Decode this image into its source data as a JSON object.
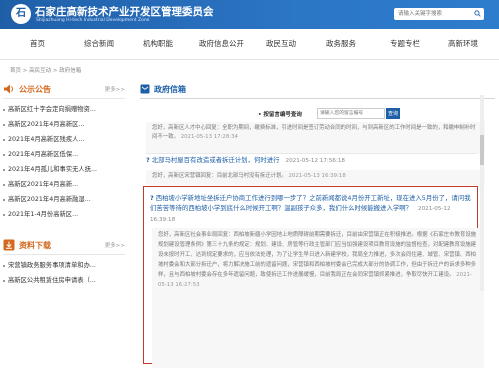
{
  "header": {
    "logo_text": "石",
    "title": "石家庄高新技术产业开发区管理委员会",
    "subtitle": "Shijiazhuang Hi-tech Industrial Development Zone",
    "search_placeholder": "请输入关键字搜索",
    "colors": {
      "bar": "#1f5fa8",
      "accent": "#d2691e",
      "highlight_border": "#c0392b"
    }
  },
  "nav": {
    "items": [
      "首页",
      "综合新闻",
      "机构职能",
      "政府信息公开",
      "政民互动",
      "政务服务",
      "专题专栏",
      "高新环境"
    ]
  },
  "breadcrumb": "首页 > 高民互动 > 政府信箱",
  "sidebar": {
    "notice": {
      "title": "公示公告",
      "more": "更多>>",
      "items": [
        "高新区红十字会定向捐赠物资...",
        "高新区2021年4月高新区...",
        "2021年4月高新区残疾人...",
        "2021年4月高新区低保...",
        "2021年4月孤儿和事实无人抚...",
        "高新区2021年4月高新...",
        "高新区2021年4月高新融湿...",
        "2021年1-4月份高新区..."
      ]
    },
    "download": {
      "title": "资料下载",
      "more": "更多>>",
      "items": [
        "宋营镇政务服务事项清单和办...",
        "高新区公共租赁住房申请表（..."
      ]
    }
  },
  "main": {
    "title": "政府信箱",
    "search_label": "• 按留言编号查询",
    "search_placeholder": "请输入您的留言编号",
    "search_button": "查询",
    "items": [
      {
        "answer": "您好，高新区人才中心回复：全职为期间，缴费标准，引进时间是签订劳动合同的时间，与到高新区的工作时间是一致的，和缴申制补时间不一致。",
        "answer_date": "2021-05-13 17:28:34"
      },
      {
        "question": "北部马村屋百有改造或者拆迁计划，何时进行",
        "question_date": "2021-05-12 17:56:18",
        "answer": "您好，高新区宋营镇回复：目前北部马村没有拆迁计划。",
        "answer_date": "2021-05-13 16:39:18"
      },
      {
        "question": "西柏坡小学新地址坐拆迁户协商工作进行到哪一步了？之前新闻都说4月份开工新址，现在进入5月份了，请问我们苦苦等待的西柏坡小学到底什么时候开工啊？温副孩子众多，我们什么时候能搬进入学啊？",
        "question_date": "2021-05-12 16:39:18",
        "answer": "您好，高新区社会事业局回复：西柏坡新疆小学因地上地质障碍前期需要拆迁，目前由宋营镇正在积极推进。根据《石家庄市教育设施规划建设管理条例》第三十九条的规定：规划、建设、房管等行政主管部门应当加强建设项目教育设施的监督检查，对配建教育设施建设未按时开工、达到规定要求的，应当依法处理，为了让学生早日进入新建学校，我局全力推进，多次会同住建、城管、宋营镇、西柏坡村委会和大部分拆迁户，将力解决施工前的遗留问题，宋营镇和西柏坡村委会已完成大部分的协调工作，但由于拆迁户的诉求多种多样，且与西柏坡村委会存在多年遗留问题，致使拆迁工作进展缓慢，目前我局正在会同宋营镇抓紧推进，争取尽快开工建设。",
        "answer_date": "2021-05-13 16:27:53"
      }
    ]
  }
}
